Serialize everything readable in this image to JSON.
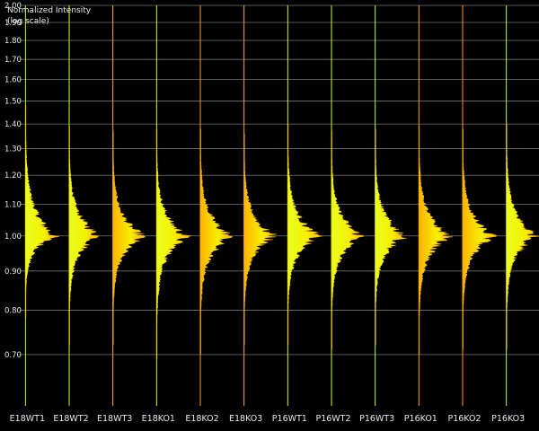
{
  "chart_data": {
    "type": "distribution",
    "ylabel_line1": "Normalized Intensity",
    "ylabel_line2": "(log scale)",
    "y_scale": "log",
    "ylim": [
      0.6,
      2.0
    ],
    "yticks": [
      0.7,
      0.8,
      0.9,
      1.0,
      1.1,
      1.2,
      1.3,
      1.4,
      1.5,
      1.6,
      1.7,
      1.8,
      1.9,
      2.0
    ],
    "ytick_labels": [
      "0.70",
      "0.80",
      "0.90",
      "1.00",
      "1.10",
      "1.20",
      "1.30",
      "1.40",
      "1.50",
      "1.60",
      "1.70",
      "1.80",
      "1.90",
      "2.00"
    ],
    "grid": true,
    "categories": [
      "E18WT1",
      "E18WT2",
      "E18WT3",
      "E18KO1",
      "E18KO2",
      "E18KO3",
      "P16WT1",
      "P16WT2",
      "P16WT3",
      "P16KO1",
      "P16KO2",
      "P16KO3"
    ],
    "series": [
      {
        "label": "E18WT1",
        "mode": 1.0,
        "min": 0.78,
        "max": 1.48,
        "line_color": "#c9ff1a"
      },
      {
        "label": "E18WT2",
        "mode": 1.0,
        "min": 0.72,
        "max": 1.39,
        "line_color": "#c9ff1a"
      },
      {
        "label": "E18WT3",
        "mode": 1.0,
        "min": 0.72,
        "max": 1.37,
        "line_color": "#ffb030"
      },
      {
        "label": "E18KO1",
        "mode": 1.0,
        "min": 0.69,
        "max": 1.38,
        "line_color": "#c9ff1a"
      },
      {
        "label": "E18KO2",
        "mode": 1.0,
        "min": 0.7,
        "max": 1.38,
        "line_color": "#ff9a28"
      },
      {
        "label": "E18KO3",
        "mode": 1.0,
        "min": 0.72,
        "max": 1.36,
        "line_color": "#ffb030"
      },
      {
        "label": "P16WT1",
        "mode": 1.0,
        "min": 0.72,
        "max": 1.4,
        "line_color": "#c9ff1a"
      },
      {
        "label": "P16WT2",
        "mode": 1.0,
        "min": 0.71,
        "max": 1.37,
        "line_color": "#c9ff1a"
      },
      {
        "label": "P16WT3",
        "mode": 1.0,
        "min": 0.72,
        "max": 1.38,
        "line_color": "#c9ff1a"
      },
      {
        "label": "P16KO1",
        "mode": 1.0,
        "min": 0.7,
        "max": 1.39,
        "line_color": "#ff9a28"
      },
      {
        "label": "P16KO2",
        "mode": 1.0,
        "min": 0.71,
        "max": 1.38,
        "line_color": "#ff9a28"
      },
      {
        "label": "P16KO3",
        "mode": 1.0,
        "min": 0.71,
        "max": 1.4,
        "line_color": "#c9ff1a"
      }
    ],
    "colors": {
      "background": "#000000",
      "grid": "#6b7a6b",
      "fill_primary": "#f5f000",
      "fill_secondary": "#ffb300",
      "text": "#e8e8e8"
    }
  }
}
